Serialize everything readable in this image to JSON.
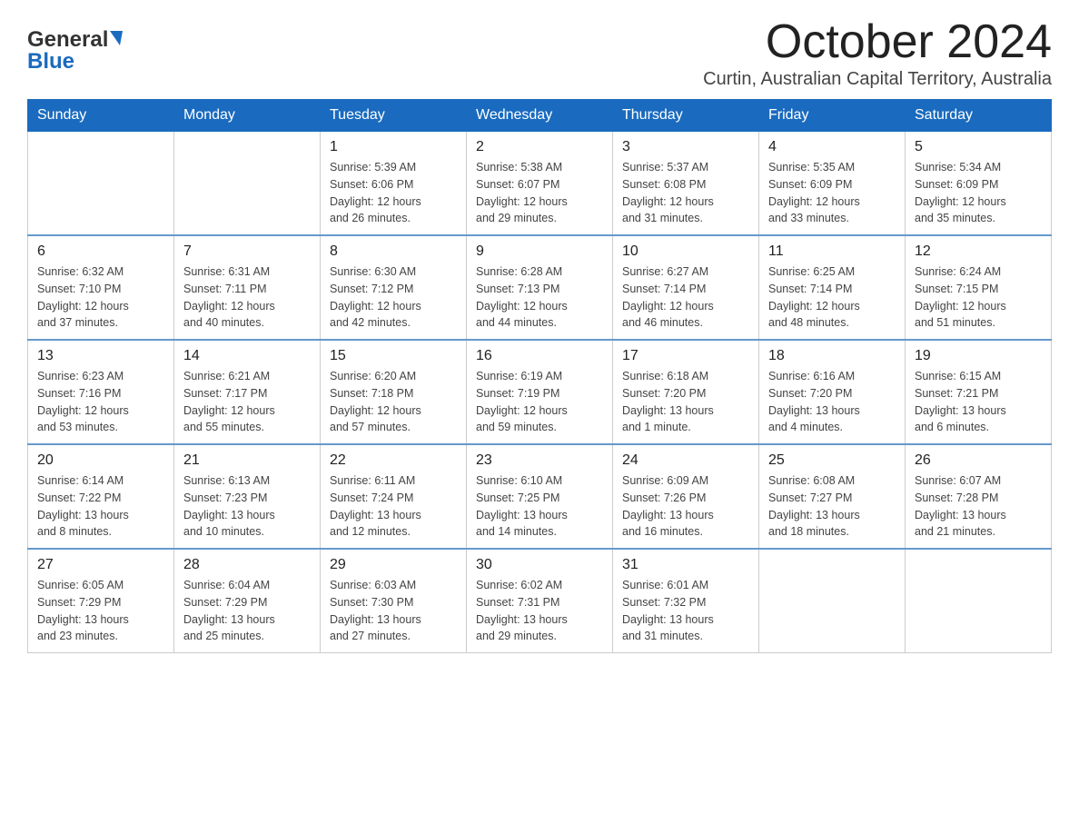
{
  "header": {
    "logo_general": "General",
    "logo_blue": "Blue",
    "month_title": "October 2024",
    "location": "Curtin, Australian Capital Territory, Australia"
  },
  "days_of_week": [
    "Sunday",
    "Monday",
    "Tuesday",
    "Wednesday",
    "Thursday",
    "Friday",
    "Saturday"
  ],
  "weeks": [
    [
      {
        "day": "",
        "info": ""
      },
      {
        "day": "",
        "info": ""
      },
      {
        "day": "1",
        "info": "Sunrise: 5:39 AM\nSunset: 6:06 PM\nDaylight: 12 hours\nand 26 minutes."
      },
      {
        "day": "2",
        "info": "Sunrise: 5:38 AM\nSunset: 6:07 PM\nDaylight: 12 hours\nand 29 minutes."
      },
      {
        "day": "3",
        "info": "Sunrise: 5:37 AM\nSunset: 6:08 PM\nDaylight: 12 hours\nand 31 minutes."
      },
      {
        "day": "4",
        "info": "Sunrise: 5:35 AM\nSunset: 6:09 PM\nDaylight: 12 hours\nand 33 minutes."
      },
      {
        "day": "5",
        "info": "Sunrise: 5:34 AM\nSunset: 6:09 PM\nDaylight: 12 hours\nand 35 minutes."
      }
    ],
    [
      {
        "day": "6",
        "info": "Sunrise: 6:32 AM\nSunset: 7:10 PM\nDaylight: 12 hours\nand 37 minutes."
      },
      {
        "day": "7",
        "info": "Sunrise: 6:31 AM\nSunset: 7:11 PM\nDaylight: 12 hours\nand 40 minutes."
      },
      {
        "day": "8",
        "info": "Sunrise: 6:30 AM\nSunset: 7:12 PM\nDaylight: 12 hours\nand 42 minutes."
      },
      {
        "day": "9",
        "info": "Sunrise: 6:28 AM\nSunset: 7:13 PM\nDaylight: 12 hours\nand 44 minutes."
      },
      {
        "day": "10",
        "info": "Sunrise: 6:27 AM\nSunset: 7:14 PM\nDaylight: 12 hours\nand 46 minutes."
      },
      {
        "day": "11",
        "info": "Sunrise: 6:25 AM\nSunset: 7:14 PM\nDaylight: 12 hours\nand 48 minutes."
      },
      {
        "day": "12",
        "info": "Sunrise: 6:24 AM\nSunset: 7:15 PM\nDaylight: 12 hours\nand 51 minutes."
      }
    ],
    [
      {
        "day": "13",
        "info": "Sunrise: 6:23 AM\nSunset: 7:16 PM\nDaylight: 12 hours\nand 53 minutes."
      },
      {
        "day": "14",
        "info": "Sunrise: 6:21 AM\nSunset: 7:17 PM\nDaylight: 12 hours\nand 55 minutes."
      },
      {
        "day": "15",
        "info": "Sunrise: 6:20 AM\nSunset: 7:18 PM\nDaylight: 12 hours\nand 57 minutes."
      },
      {
        "day": "16",
        "info": "Sunrise: 6:19 AM\nSunset: 7:19 PM\nDaylight: 12 hours\nand 59 minutes."
      },
      {
        "day": "17",
        "info": "Sunrise: 6:18 AM\nSunset: 7:20 PM\nDaylight: 13 hours\nand 1 minute."
      },
      {
        "day": "18",
        "info": "Sunrise: 6:16 AM\nSunset: 7:20 PM\nDaylight: 13 hours\nand 4 minutes."
      },
      {
        "day": "19",
        "info": "Sunrise: 6:15 AM\nSunset: 7:21 PM\nDaylight: 13 hours\nand 6 minutes."
      }
    ],
    [
      {
        "day": "20",
        "info": "Sunrise: 6:14 AM\nSunset: 7:22 PM\nDaylight: 13 hours\nand 8 minutes."
      },
      {
        "day": "21",
        "info": "Sunrise: 6:13 AM\nSunset: 7:23 PM\nDaylight: 13 hours\nand 10 minutes."
      },
      {
        "day": "22",
        "info": "Sunrise: 6:11 AM\nSunset: 7:24 PM\nDaylight: 13 hours\nand 12 minutes."
      },
      {
        "day": "23",
        "info": "Sunrise: 6:10 AM\nSunset: 7:25 PM\nDaylight: 13 hours\nand 14 minutes."
      },
      {
        "day": "24",
        "info": "Sunrise: 6:09 AM\nSunset: 7:26 PM\nDaylight: 13 hours\nand 16 minutes."
      },
      {
        "day": "25",
        "info": "Sunrise: 6:08 AM\nSunset: 7:27 PM\nDaylight: 13 hours\nand 18 minutes."
      },
      {
        "day": "26",
        "info": "Sunrise: 6:07 AM\nSunset: 7:28 PM\nDaylight: 13 hours\nand 21 minutes."
      }
    ],
    [
      {
        "day": "27",
        "info": "Sunrise: 6:05 AM\nSunset: 7:29 PM\nDaylight: 13 hours\nand 23 minutes."
      },
      {
        "day": "28",
        "info": "Sunrise: 6:04 AM\nSunset: 7:29 PM\nDaylight: 13 hours\nand 25 minutes."
      },
      {
        "day": "29",
        "info": "Sunrise: 6:03 AM\nSunset: 7:30 PM\nDaylight: 13 hours\nand 27 minutes."
      },
      {
        "day": "30",
        "info": "Sunrise: 6:02 AM\nSunset: 7:31 PM\nDaylight: 13 hours\nand 29 minutes."
      },
      {
        "day": "31",
        "info": "Sunrise: 6:01 AM\nSunset: 7:32 PM\nDaylight: 13 hours\nand 31 minutes."
      },
      {
        "day": "",
        "info": ""
      },
      {
        "day": "",
        "info": ""
      }
    ]
  ]
}
